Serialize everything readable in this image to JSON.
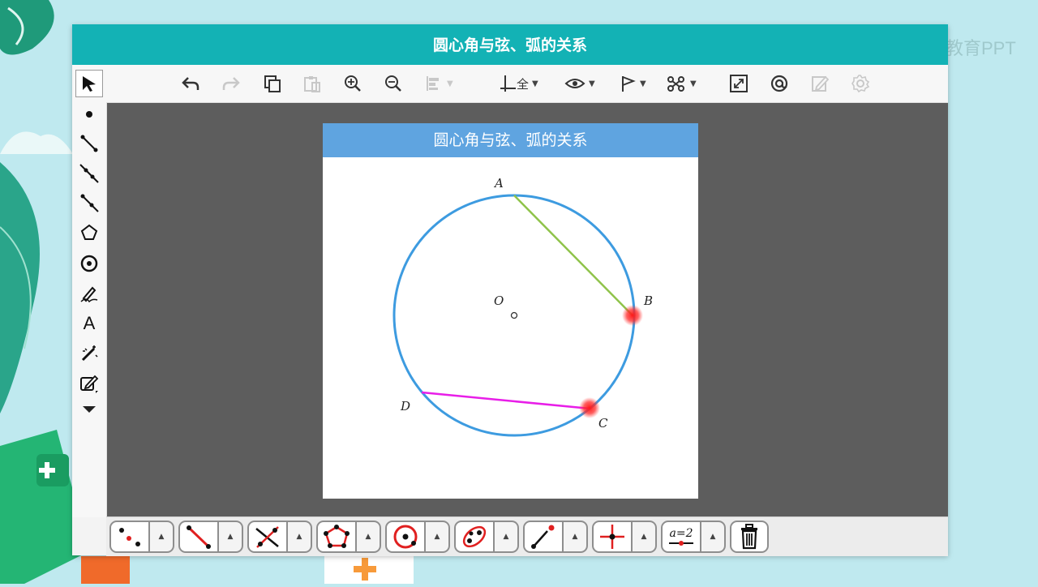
{
  "app": {
    "title": "圆心角与弦、弧的关系",
    "watermark": "教育PPT"
  },
  "toolbar": {
    "items": [
      {
        "name": "undo-icon",
        "enabled": true
      },
      {
        "name": "redo-icon",
        "enabled": false
      },
      {
        "name": "copy-icon",
        "enabled": true
      },
      {
        "name": "paste-icon",
        "enabled": false
      },
      {
        "name": "zoom-in-icon",
        "enabled": true
      },
      {
        "name": "zoom-out-icon",
        "enabled": true
      },
      {
        "name": "align-icon",
        "enabled": false
      },
      {
        "name": "axes-icon",
        "enabled": true
      },
      {
        "name": "eye-icon",
        "enabled": true
      },
      {
        "name": "flag-icon",
        "enabled": true
      },
      {
        "name": "style-icon",
        "enabled": true
      },
      {
        "name": "fullscreen-icon",
        "enabled": true
      },
      {
        "name": "at-icon",
        "enabled": true
      },
      {
        "name": "edit-icon",
        "enabled": false
      },
      {
        "name": "settings-icon",
        "enabled": false
      }
    ],
    "axes_label": "全"
  },
  "sidebar": {
    "tools": [
      "select-arrow-icon",
      "point-icon",
      "segment-icon",
      "line-icon",
      "ray-icon",
      "polygon-icon",
      "circle-icon",
      "pen-icon",
      "text-icon",
      "magic-wand-icon",
      "edit-note-icon",
      "expand-down-icon"
    ],
    "text_tool_label": "A"
  },
  "sheet": {
    "title": "圆心角与弦、弧的关系"
  },
  "figure": {
    "center_label": "O",
    "points": [
      {
        "label": "A"
      },
      {
        "label": "B"
      },
      {
        "label": "C"
      },
      {
        "label": "D"
      }
    ],
    "colors": {
      "circle": "#3d9be0",
      "chord_AB": "#8fc34a",
      "chord_CD": "#e81ee8",
      "highlight": "#ff2020"
    }
  },
  "bottombar": {
    "groups": [
      "points-tool-icon",
      "segment-tool-icon",
      "intersect-tool-icon",
      "polygon-tool-icon",
      "circle-tool-icon",
      "conic-tool-icon",
      "ray-tool-icon",
      "perpendicular-tool-icon",
      "slider-tool-icon"
    ],
    "slider_label": "a=2",
    "delete": "trash-icon"
  }
}
